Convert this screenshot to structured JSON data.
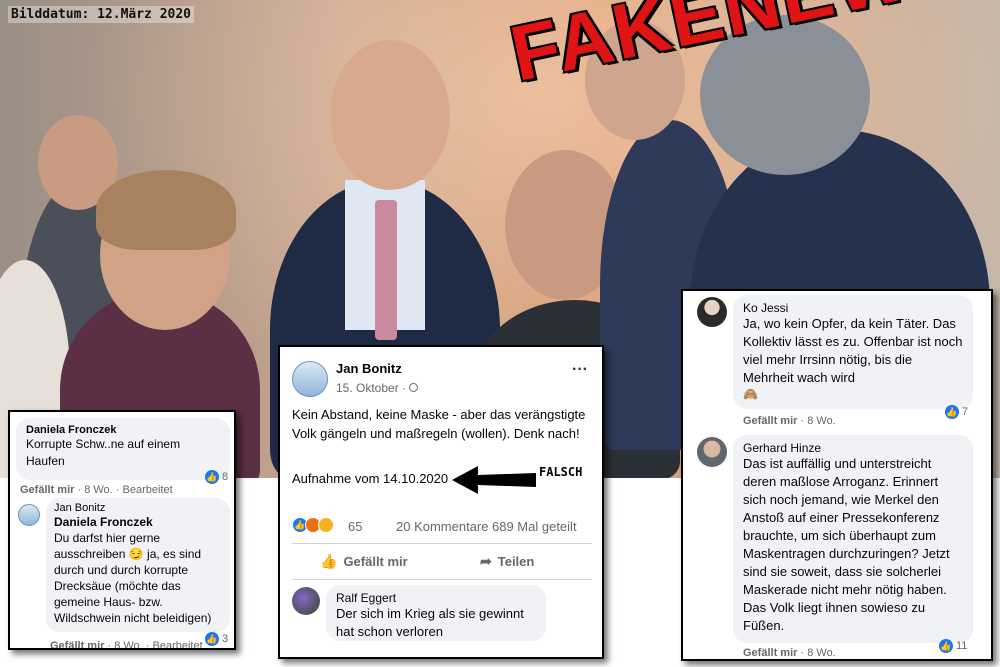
{
  "photo": {
    "date_label": "Bilddatum: 12.März 2020",
    "stamp": "FAKENEWS!"
  },
  "left_card": {
    "comment1": {
      "author": "Daniela Fronczek",
      "text": "Korrupte Schw..ne auf einem Haufen",
      "like": "Gefällt mir",
      "time": "8 Wo.",
      "edited": "Bearbeitet",
      "reactions": "8"
    },
    "reply": {
      "author": "Jan Bonitz",
      "mention": "Daniela Fronczek",
      "text_before_emoji": "Du darfst hier gerne ausschreiben",
      "emoji": "😏",
      "text_after_emoji": "ja, es sind durch und durch korrupte Drecksäue (möchte das gemeine Haus- bzw. Wildschwein nicht beleidigen)",
      "like": "Gefällt mir",
      "time": "8 Wo.",
      "edited": "Bearbeitet",
      "reactions": "3"
    }
  },
  "post": {
    "author": "Jan Bonitz",
    "date": "15. Oktober",
    "text": "Kein Abstand, keine Maske - aber das verängstigte Volk gängeln und maßregeln (wollen). Denk nach!",
    "caption": "Aufnahme vom 14.10.2020",
    "annotation": "FALSCH",
    "reaction_count": "65",
    "comments": "20 Kommentare",
    "shares": "689 Mal geteilt",
    "like_label": "Gefällt mir",
    "share_label": "Teilen",
    "menu": "···",
    "comment": {
      "author": "Ralf Eggert",
      "text": "Der sich im Krieg als sie gewinnt hat schon verloren"
    }
  },
  "right_card": {
    "comment1": {
      "author": "Ko Jessi",
      "text": "Ja, wo kein Opfer, da kein Täter. Das Kollektiv lässt es zu. Offenbar ist noch viel mehr Irrsinn nötig, bis die Mehrheit wach wird",
      "emoji": "🙈",
      "like": "Gefällt mir",
      "time": "8 Wo.",
      "reactions": "7"
    },
    "comment2": {
      "author": "Gerhard Hinze",
      "text": "Das ist auffällig und unterstreicht deren maßlose Arroganz. Erinnert sich noch jemand, wie Merkel den Anstoß auf einer Pressekonferenz brauchte, um sich überhaupt zum Maskentragen durchzuringen? Jetzt sind sie soweit, dass sie solcherlei Maskerade nicht mehr nötig haben. Das Volk liegt ihnen sowieso zu Füßen.",
      "like": "Gefällt mir",
      "time": "8 Wo.",
      "reactions": "11"
    }
  },
  "colors": {
    "accent": "#1877f2",
    "stamp_red": "#e01414",
    "bubble": "#f0f2f5"
  }
}
